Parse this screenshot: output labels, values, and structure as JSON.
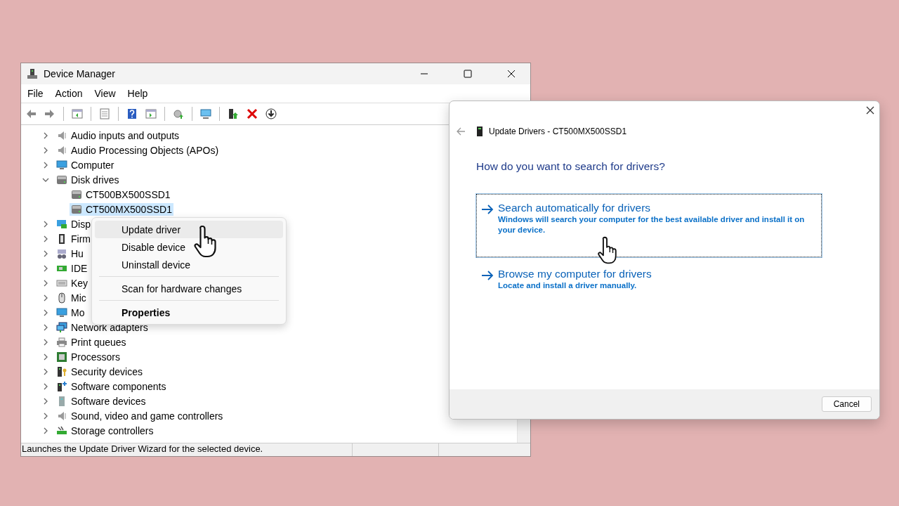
{
  "device_manager": {
    "title": "Device Manager",
    "menu": [
      "File",
      "Action",
      "View",
      "Help"
    ],
    "tree": [
      {
        "label": "Audio inputs and outputs",
        "kind": "speaker",
        "expanded": false,
        "selected": false
      },
      {
        "label": "Audio Processing Objects (APOs)",
        "kind": "speaker",
        "expanded": false,
        "selected": false
      },
      {
        "label": "Computer",
        "kind": "monitor",
        "expanded": false,
        "selected": false
      },
      {
        "label": "Disk drives",
        "kind": "disk",
        "expanded": true,
        "selected": false,
        "children": [
          {
            "label": "CT500BX500SSD1",
            "kind": "disk",
            "selected": false
          },
          {
            "label": "CT500MX500SSD1",
            "kind": "disk",
            "selected": true
          }
        ]
      },
      {
        "label": "Disp",
        "kind": "display",
        "expanded": false,
        "selected": false
      },
      {
        "label": "Firm",
        "kind": "chip",
        "expanded": false,
        "selected": false
      },
      {
        "label": "Hu",
        "kind": "hid",
        "expanded": false,
        "selected": false
      },
      {
        "label": "IDE",
        "kind": "card",
        "expanded": false,
        "selected": false
      },
      {
        "label": "Key",
        "kind": "keyboard",
        "expanded": false,
        "selected": false
      },
      {
        "label": "Mic",
        "kind": "mouse",
        "expanded": false,
        "selected": false
      },
      {
        "label": "Mo",
        "kind": "monitor",
        "expanded": false,
        "selected": false
      },
      {
        "label": "Network adapters",
        "kind": "network",
        "expanded": false,
        "selected": false
      },
      {
        "label": "Print queues",
        "kind": "printer",
        "expanded": false,
        "selected": false
      },
      {
        "label": "Processors",
        "kind": "processor",
        "expanded": false,
        "selected": false
      },
      {
        "label": "Security devices",
        "kind": "security",
        "expanded": false,
        "selected": false
      },
      {
        "label": "Software components",
        "kind": "software",
        "expanded": false,
        "selected": false
      },
      {
        "label": "Software devices",
        "kind": "softdevice",
        "expanded": false,
        "selected": false
      },
      {
        "label": "Sound, video and game controllers",
        "kind": "speaker",
        "expanded": false,
        "selected": false
      },
      {
        "label": "Storage controllers",
        "kind": "storage",
        "expanded": false,
        "selected": false
      }
    ],
    "context_menu": [
      {
        "label": "Update driver",
        "selected": true,
        "default": false,
        "separator_before": false
      },
      {
        "label": "Disable device",
        "selected": false,
        "default": false,
        "separator_before": false
      },
      {
        "label": "Uninstall device",
        "selected": false,
        "default": false,
        "separator_before": false
      },
      {
        "label": "Scan for hardware changes",
        "selected": false,
        "default": false,
        "separator_before": true
      },
      {
        "label": "Properties",
        "selected": false,
        "default": true,
        "separator_before": true
      }
    ],
    "status_bar": "Launches the Update Driver Wizard for the selected device."
  },
  "update_dialog": {
    "title": "Update Drivers - CT500MX500SSD1",
    "heading": "How do you want to search for drivers?",
    "options": [
      {
        "title": "Search automatically for drivers",
        "description": "Windows will search your computer for the best available driver and install it on your device.",
        "focused": true
      },
      {
        "title": "Browse my computer for drivers",
        "description": "Locate and install a driver manually.",
        "focused": false
      }
    ],
    "buttons": [
      "Cancel"
    ]
  }
}
